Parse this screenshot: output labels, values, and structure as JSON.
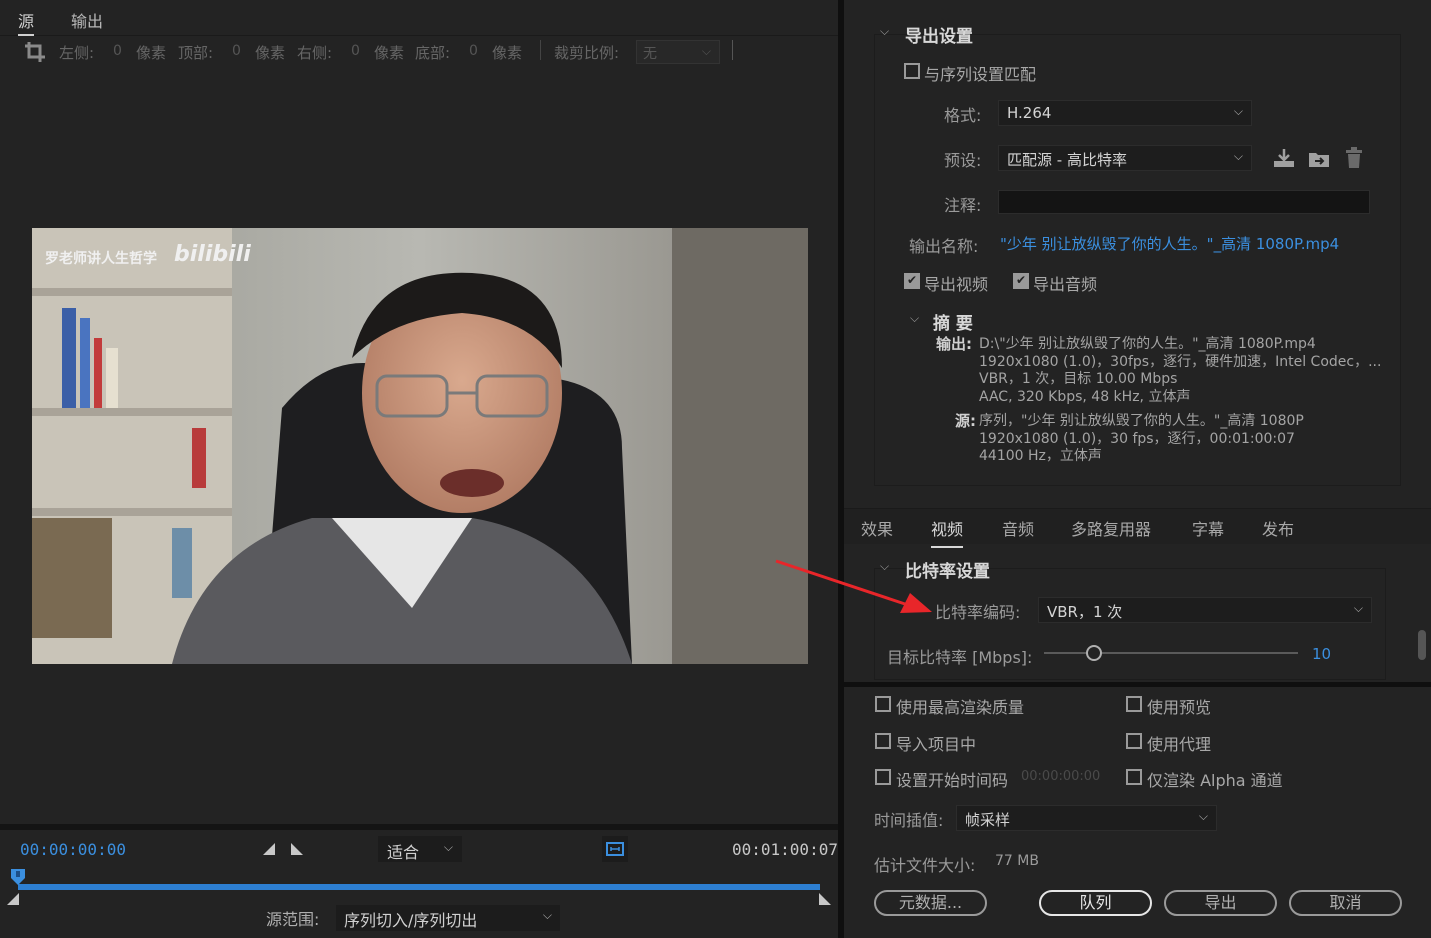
{
  "source_tabs": {
    "source": "源",
    "output": "输出"
  },
  "crop": {
    "left_label": "左侧:",
    "left_value": "0",
    "left_unit": "像素",
    "top_label": "顶部:",
    "top_value": "0",
    "top_unit": "像素",
    "right_label": "右侧:",
    "right_value": "0",
    "right_unit": "像素",
    "bottom_label": "底部:",
    "bottom_value": "0",
    "bottom_unit": "像素",
    "aspect_label": "裁剪比例:",
    "aspect_value": "无"
  },
  "video": {
    "watermark_text": "罗老师讲人生哲学",
    "watermark_logo": "bilibili"
  },
  "timeline": {
    "start": "00:00:00:00",
    "end": "00:01:00:07",
    "fit_value": "适合",
    "range_label": "源范围:",
    "range_value": "序列切入/序列切出"
  },
  "export_settings": {
    "header": "导出设置",
    "match_sequence": "与序列设置匹配",
    "format_label": "格式:",
    "format_value": "H.264",
    "preset_label": "预设:",
    "preset_value": "匹配源 - 高比特率",
    "comment_label": "注释:",
    "comment_value": "",
    "output_name_label": "输出名称:",
    "output_name_value": "\"少年 别让放纵毁了你的人生。\"_高清 1080P.mp4",
    "export_video": "导出视频",
    "export_audio": "导出音频",
    "summary_header": "摘 要",
    "summary_output_label": "输出:",
    "summary_output_lines": [
      "D:\\\"少年 别让放纵毁了你的人生。\"_高清 1080P.mp4",
      "1920x1080 (1.0)，30fps，逐行，硬件加速，Intel Codec，...",
      "VBR，1 次，目标 10.00 Mbps",
      "AAC, 320 Kbps, 48  kHz, 立体声"
    ],
    "summary_source_label": "源:",
    "summary_source_lines": [
      "序列，\"少年 别让放纵毁了你的人生。\"_高清 1080P",
      "1920x1080 (1.0)，30 fps，逐行，00:01:00:07",
      "44100 Hz，立体声"
    ]
  },
  "settings_tabs": [
    "效果",
    "视频",
    "音频",
    "多路复用器",
    "字幕",
    "发布"
  ],
  "bitrate": {
    "header": "比特率设置",
    "encoding_label": "比特率编码:",
    "encoding_value": "VBR，1 次",
    "target_label": "目标比特率 [Mbps]:",
    "target_value": "10",
    "slider_fraction": 0.196
  },
  "options": {
    "max_quality": "使用最高渲染质量",
    "use_preview": "使用预览",
    "import_project": "导入项目中",
    "use_proxy": "使用代理",
    "set_start_tc": "设置开始时间码",
    "start_tc_value": "00:00:00:00",
    "alpha_only": "仅渲染 Alpha 通道",
    "interp_label": "时间插值:",
    "interp_value": "帧采样",
    "filesize_label": "估计文件大小:",
    "filesize_value": "77 MB"
  },
  "buttons": {
    "metadata": "元数据...",
    "queue": "队列",
    "export": "导出",
    "cancel": "取消"
  },
  "colors": {
    "accent_blue": "#3b8fdf",
    "arrow_red": "#e8262a"
  }
}
